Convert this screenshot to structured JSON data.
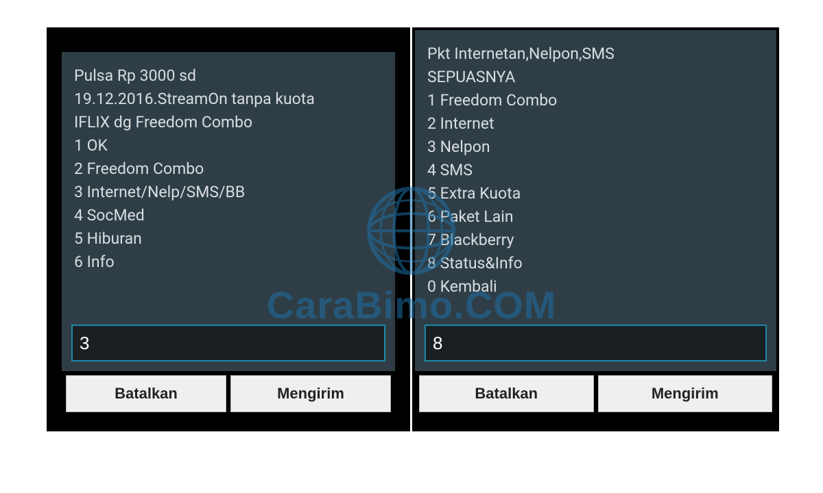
{
  "watermark": {
    "text": "CaraBimo.COM"
  },
  "colors": {
    "dialog_bg": "#2f3e46",
    "input_border": "#1d8aa8",
    "watermark": "#1d6fa5"
  },
  "left": {
    "message": "Pulsa Rp 3000 sd\n19.12.2016.StreamOn tanpa kuota\nIFLIX dg Freedom Combo\n1 OK\n2 Freedom Combo\n3 Internet/Nelp/SMS/BB\n4 SocMed\n5 Hiburan\n6 Info",
    "input_value": "3",
    "cancel_label": "Batalkan",
    "send_label": "Mengirim"
  },
  "right": {
    "message": "Pkt Internetan,Nelpon,SMS\nSEPUASNYA\n1 Freedom Combo\n2 Internet\n3 Nelpon\n4 SMS\n5 Extra Kuota\n6 Paket Lain\n7 Blackberry\n8 Status&Info\n0 Kembali",
    "input_value": "8",
    "cancel_label": "Batalkan",
    "send_label": "Mengirim"
  }
}
